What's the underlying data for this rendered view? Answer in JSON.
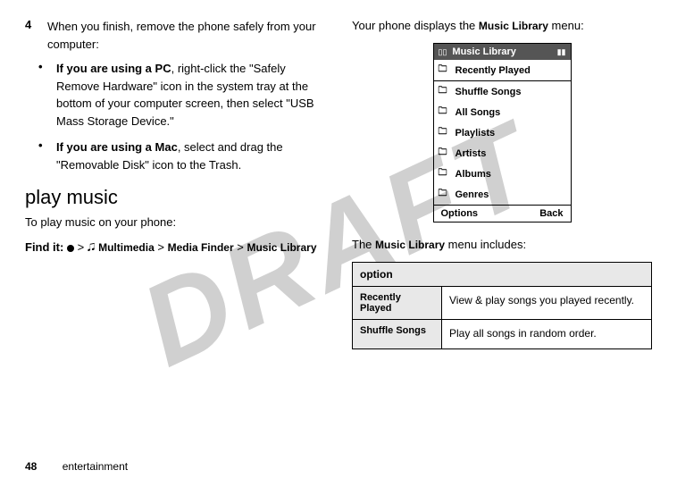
{
  "watermark": "DRAFT",
  "left": {
    "step_num": "4",
    "step_text_a": "When you finish, remove the phone safely from your computer:",
    "bullet1_prefix": "If you are using a PC",
    "bullet1_rest": ", right-click the \"Safely Remove Hardware\" icon in the system tray at the bottom of your computer screen, then select \"USB Mass Storage Device.\"",
    "bullet2_prefix": "If you are using a Mac",
    "bullet2_rest": ", select and drag the \"Removable Disk\" icon to the Trash.",
    "section_title": "play music",
    "intro": "To play music on your phone:",
    "findit_label": "Find it:",
    "findit_multimedia": "Multimedia",
    "findit_mediafinder": "Media Finder",
    "findit_musiclibrary": "Music Library"
  },
  "right": {
    "intro": "Your phone displays the ",
    "intro_bold": "Music Library",
    "intro_suffix": " menu:",
    "menu": {
      "title": "Music Library",
      "items": [
        "Recently Played",
        "Shuffle Songs",
        "All Songs",
        "Playlists",
        "Artists",
        "Albums",
        "Genres"
      ],
      "opt_left": "Options",
      "opt_right": "Back"
    },
    "includes_pre": "The ",
    "includes_bold": "Music Library",
    "includes_post": " menu includes:",
    "table": {
      "header": "option",
      "row1_label": "Recently Played",
      "row1_desc": "View & play songs you played recently.",
      "row2_label": "Shuffle Songs",
      "row2_desc": "Play all songs in random order."
    }
  },
  "footer": {
    "page": "48",
    "section": "entertainment"
  }
}
